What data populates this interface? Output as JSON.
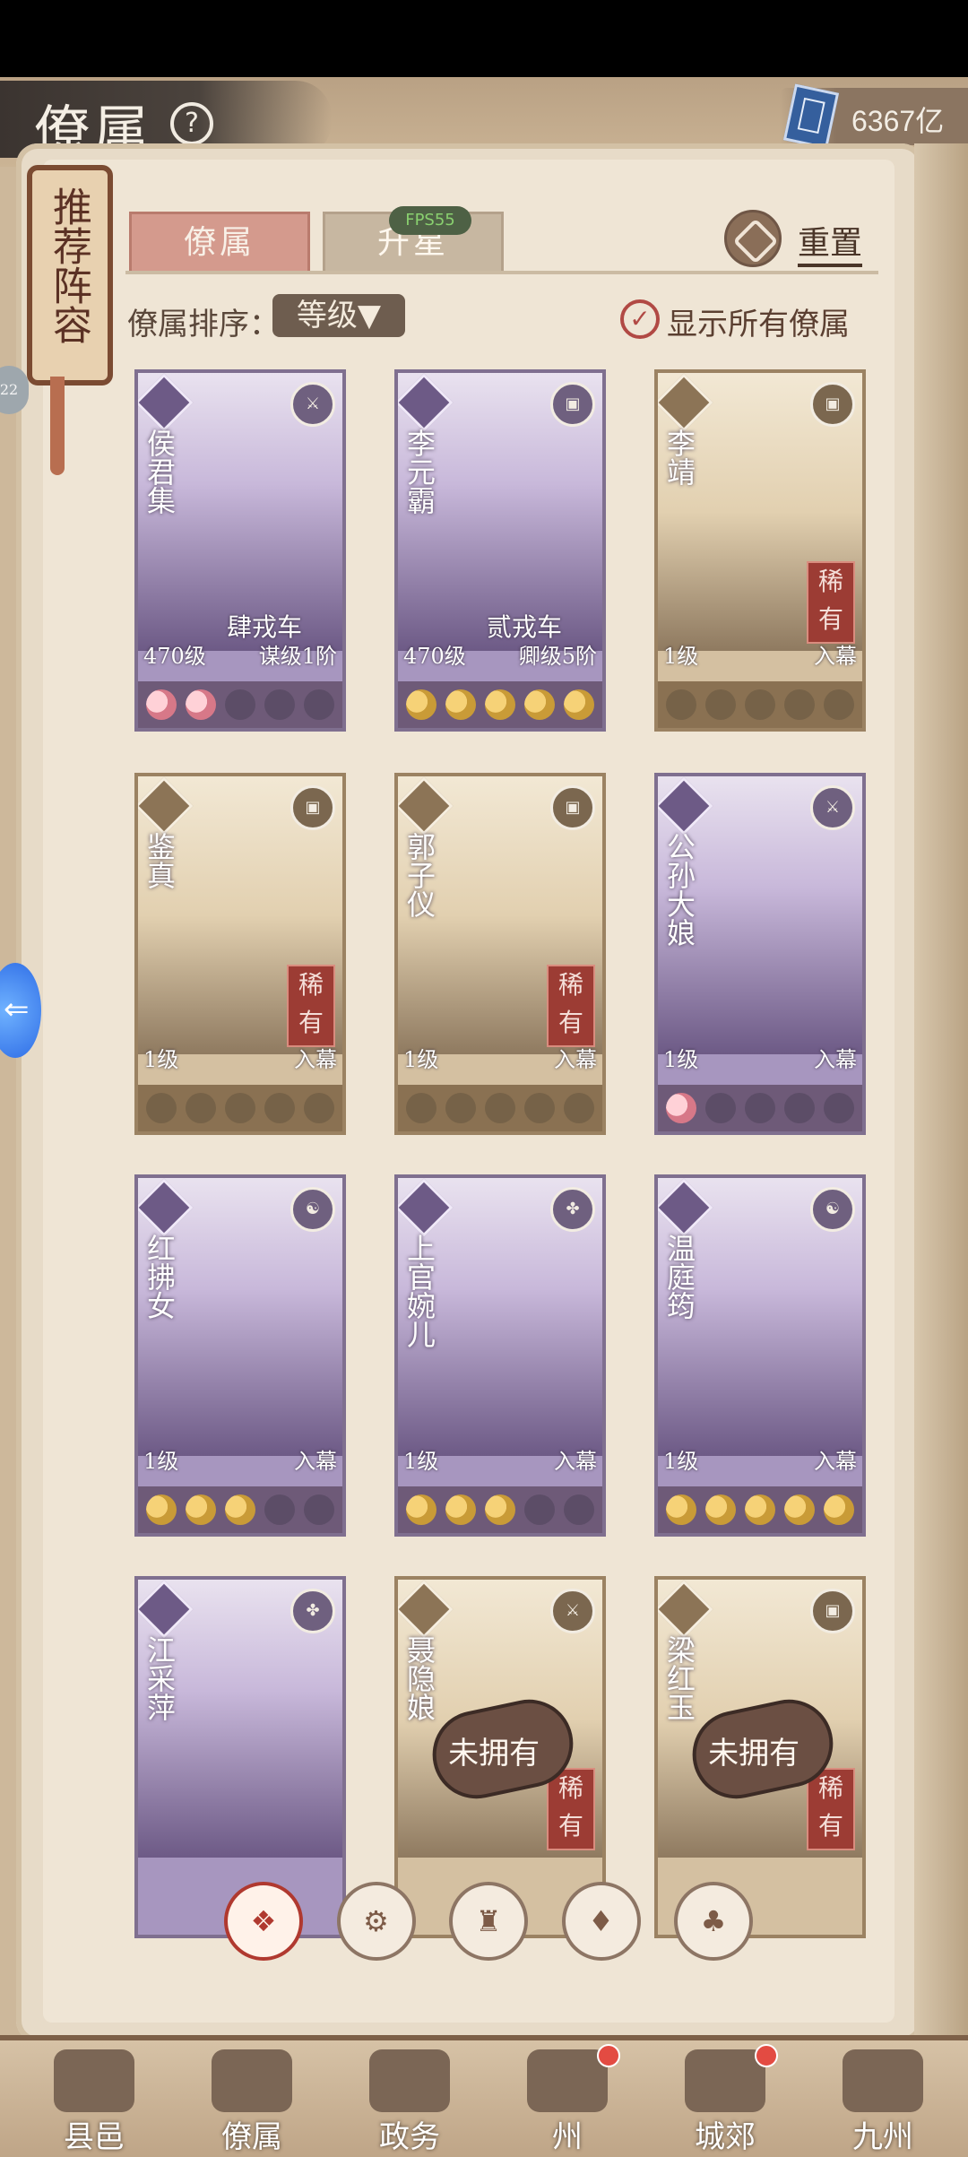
{
  "header": {
    "title": "僚属",
    "help_icon": "?",
    "currency": "6367亿"
  },
  "side": {
    "scroll_text": "推荐阵容",
    "pill_text": "22"
  },
  "tabs": {
    "active": "僚属",
    "inactive": "升星",
    "fps": "FPS55"
  },
  "reset": "重置",
  "sort": {
    "label": "僚属排序：",
    "value": "等级▼"
  },
  "toggle": {
    "label": "显示所有僚属",
    "checked": true
  },
  "cards": [
    {
      "name": "侯君集",
      "rank": "肆戎车",
      "left": "470级",
      "right": "谋级1阶",
      "stars": [
        "pink",
        "pink",
        "empty",
        "empty",
        "empty"
      ],
      "type_icon": "⚔",
      "rare": ""
    },
    {
      "name": "李元霸",
      "rank": "贰戎车",
      "left": "470级",
      "right": "卿级5阶",
      "stars": [
        "gold",
        "gold",
        "gold",
        "gold",
        "gold"
      ],
      "type_icon": "▣",
      "rare": ""
    },
    {
      "name": "李靖",
      "rank": "",
      "left": "1级",
      "right": "入幕",
      "stars": [
        "gold",
        "gold",
        "empty",
        "empty",
        "empty"
      ],
      "type_icon": "▣",
      "rare": "稀有"
    },
    {
      "name": "鉴真",
      "rank": "",
      "left": "1级",
      "right": "入幕",
      "stars": [
        "gold",
        "gold",
        "empty",
        "empty",
        "empty"
      ],
      "type_icon": "▣",
      "rare": "稀有"
    },
    {
      "name": "郭子仪",
      "rank": "",
      "left": "1级",
      "right": "入幕",
      "stars": [
        "gold",
        "gold",
        "empty",
        "empty",
        "empty"
      ],
      "type_icon": "▣",
      "rare": "稀有"
    },
    {
      "name": "公孙大娘",
      "rank": "",
      "left": "1级",
      "right": "入幕",
      "stars": [
        "pink",
        "empty",
        "empty",
        "empty",
        "empty"
      ],
      "type_icon": "⚔",
      "rare": ""
    },
    {
      "name": "红拂女",
      "rank": "",
      "left": "1级",
      "right": "入幕",
      "stars": [
        "gold",
        "gold",
        "gold",
        "empty",
        "empty"
      ],
      "type_icon": "☯",
      "rare": ""
    },
    {
      "name": "上官婉儿",
      "rank": "",
      "left": "1级",
      "right": "入幕",
      "stars": [
        "gold",
        "gold",
        "gold",
        "empty",
        "empty"
      ],
      "type_icon": "✤",
      "rare": ""
    },
    {
      "name": "温庭筠",
      "rank": "",
      "left": "1级",
      "right": "入幕",
      "stars": [
        "gold",
        "gold",
        "gold",
        "gold",
        "gold"
      ],
      "type_icon": "☯",
      "rare": ""
    },
    {
      "name": "江采萍",
      "rank": "",
      "left": "",
      "right": "",
      "stars": [],
      "type_icon": "✤",
      "rare": ""
    },
    {
      "name": "聂隐娘",
      "rank": "",
      "left": "",
      "right": "",
      "stars": [],
      "type_icon": "⚔",
      "rare": "稀有",
      "locked": "未拥有"
    },
    {
      "name": "梁红玉",
      "rank": "",
      "left": "",
      "right": "",
      "stars": [],
      "type_icon": "▣",
      "rare": "稀有",
      "locked": "未拥有"
    }
  ],
  "factions": [
    "❖",
    "⚙",
    "♜",
    "♦",
    "♣"
  ],
  "bottom_nav": [
    {
      "label": "县邑",
      "dot": false
    },
    {
      "label": "僚属",
      "dot": false
    },
    {
      "label": "政务",
      "dot": false
    },
    {
      "label": "州",
      "dot": true
    },
    {
      "label": "城郊",
      "dot": true
    },
    {
      "label": "九州",
      "dot": false
    }
  ]
}
